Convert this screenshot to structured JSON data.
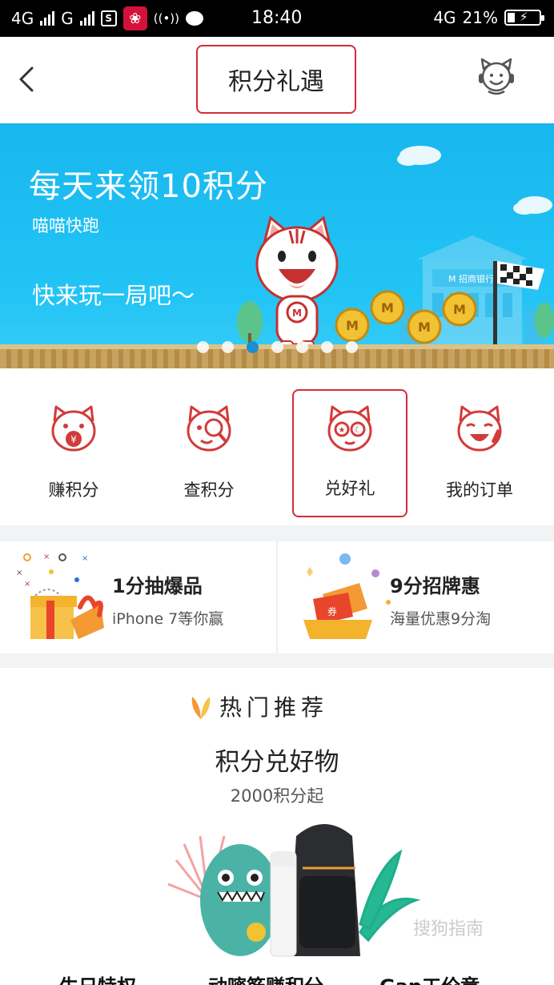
{
  "status_bar": {
    "net1": "4G",
    "net2": "G",
    "time": "18:40",
    "net3": "4G",
    "battery": "21%"
  },
  "nav": {
    "title": "积分礼遇"
  },
  "banner": {
    "headline": "每天来领10积分",
    "subtitle": "喵喵快跑",
    "cta": "快来玩一局吧～"
  },
  "categories": [
    {
      "label": "赚积分"
    },
    {
      "label": "查积分"
    },
    {
      "label": "兑好礼"
    },
    {
      "label": "我的订单"
    }
  ],
  "promos": [
    {
      "title": "1分抽爆品",
      "subtitle": "iPhone 7等你赢"
    },
    {
      "title": "9分招牌惠",
      "subtitle": "海量优惠9分淘"
    }
  ],
  "recommend": {
    "heading": "热门推荐",
    "product_title": "积分兑好物",
    "product_subtitle": "2000积分起",
    "bottom_items": [
      "生日特权",
      "动嘧筋赚积分",
      "Gap工价章"
    ],
    "watermark": "搜狗指南"
  },
  "colors": {
    "accent_red": "#d42b3a",
    "banner_blue": "#1db9ef",
    "coin_gold": "#f1c232"
  }
}
